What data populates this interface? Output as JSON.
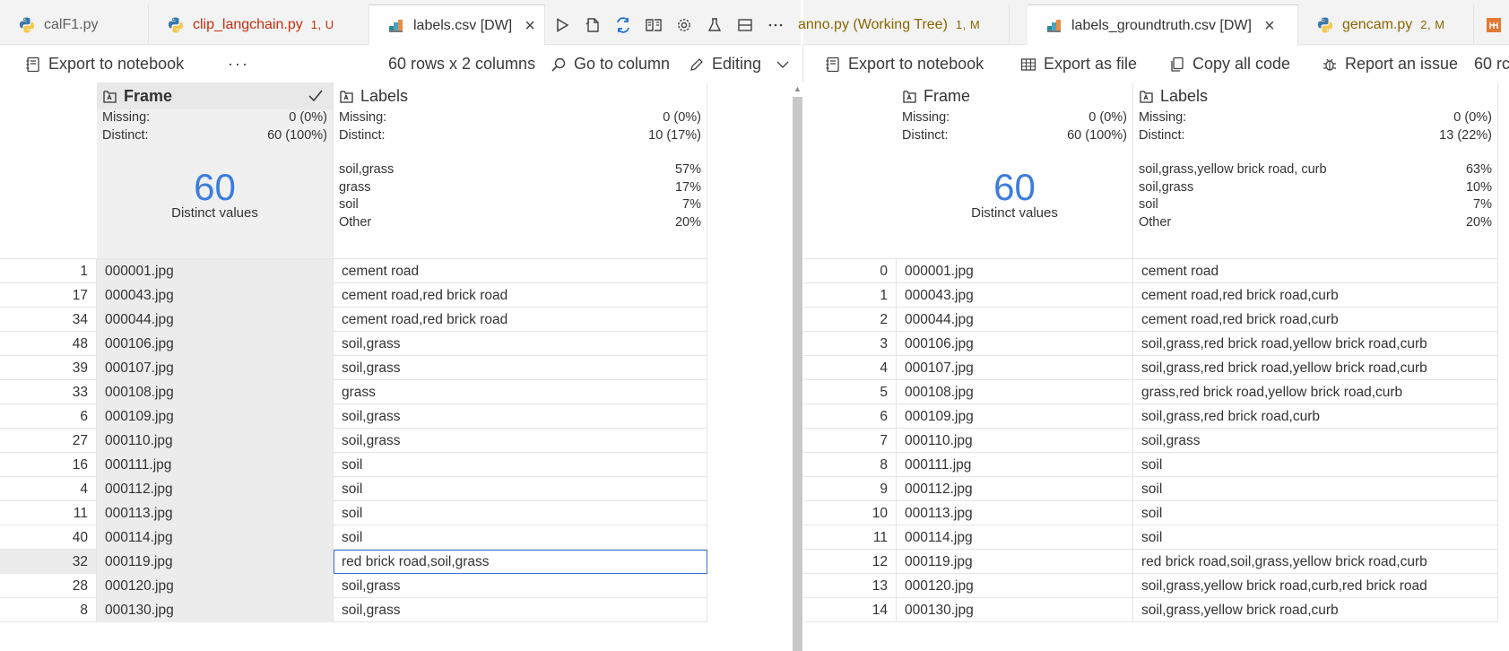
{
  "tabs_left": [
    {
      "label": "calF1.py",
      "mod": "",
      "style": "plain",
      "icon": "python-icon"
    },
    {
      "label": "clip_langchain.py",
      "mod": "1, U",
      "style": "red",
      "icon": "python-icon"
    },
    {
      "label": "labels.csv [DW]",
      "mod": "",
      "style": "active",
      "icon": "data-wrangler-icon"
    }
  ],
  "tabs_right": [
    {
      "label": "anno.py (Working Tree)",
      "mod": "1, M",
      "style": "yellow",
      "icon": ""
    },
    {
      "label": "labels_groundtruth.csv [DW]",
      "mod": "",
      "style": "active",
      "icon": "data-wrangler-icon"
    },
    {
      "label": "gencam.py",
      "mod": "2, M",
      "style": "yellow",
      "icon": "python-icon"
    }
  ],
  "tab_close_glyph": "×",
  "tab_actions": [
    "run-icon",
    "open-file-icon",
    "compare-icon",
    "preview-icon",
    "gear-icon",
    "flask-icon",
    "split-editor-icon",
    "more-icon"
  ],
  "left_toolbar": {
    "export_notebook": "Export to notebook",
    "more": "···",
    "summary": "60 rows x 2 columns",
    "goto_column": "Go to column",
    "editing": "Editing"
  },
  "right_toolbar": {
    "export_notebook": "Export to notebook",
    "export_file": "Export as file",
    "copy_code": "Copy all code",
    "report_issue": "Report an issue",
    "summary_partial": "60 rc"
  },
  "left_grid": {
    "columns": [
      {
        "name": "Frame",
        "selected": true,
        "missing_label": "Missing:",
        "missing": "0 (0%)",
        "distinct_label": "Distinct:",
        "distinct": "60 (100%)",
        "big_number": "60",
        "big_caption": "Distinct values"
      },
      {
        "name": "Labels",
        "selected": false,
        "missing_label": "Missing:",
        "missing": "0 (0%)",
        "distinct_label": "Distinct:",
        "distinct": "10 (17%)",
        "top_values": [
          {
            "value": "soil,grass",
            "pct": "57%"
          },
          {
            "value": "grass",
            "pct": "17%"
          },
          {
            "value": "soil",
            "pct": "7%"
          },
          {
            "value": "Other",
            "pct": "20%"
          }
        ]
      }
    ],
    "rows": [
      {
        "idx": "1",
        "frame": "000001.jpg",
        "labels": "cement road"
      },
      {
        "idx": "17",
        "frame": "000043.jpg",
        "labels": "cement road,red brick road"
      },
      {
        "idx": "34",
        "frame": "000044.jpg",
        "labels": "cement road,red brick road"
      },
      {
        "idx": "48",
        "frame": "000106.jpg",
        "labels": "soil,grass"
      },
      {
        "idx": "39",
        "frame": "000107.jpg",
        "labels": "soil,grass"
      },
      {
        "idx": "33",
        "frame": "000108.jpg",
        "labels": "grass"
      },
      {
        "idx": "6",
        "frame": "000109.jpg",
        "labels": "soil,grass"
      },
      {
        "idx": "27",
        "frame": "000110.jpg",
        "labels": "soil,grass"
      },
      {
        "idx": "16",
        "frame": "000111.jpg",
        "labels": "soil"
      },
      {
        "idx": "4",
        "frame": "000112.jpg",
        "labels": "soil"
      },
      {
        "idx": "11",
        "frame": "000113.jpg",
        "labels": "soil"
      },
      {
        "idx": "40",
        "frame": "000114.jpg",
        "labels": "soil"
      },
      {
        "idx": "32",
        "frame": "000119.jpg",
        "labels": "red brick road,soil,grass",
        "focused": true
      },
      {
        "idx": "28",
        "frame": "000120.jpg",
        "labels": "soil,grass"
      },
      {
        "idx": "8",
        "frame": "000130.jpg",
        "labels": "soil,grass"
      }
    ]
  },
  "right_grid": {
    "columns": [
      {
        "name": "Frame",
        "missing_label": "Missing:",
        "missing": "0 (0%)",
        "distinct_label": "Distinct:",
        "distinct": "60 (100%)",
        "big_number": "60",
        "big_caption": "Distinct values"
      },
      {
        "name": "Labels",
        "missing_label": "Missing:",
        "missing": "0 (0%)",
        "distinct_label": "Distinct:",
        "distinct": "13 (22%)",
        "top_values": [
          {
            "value": "soil,grass,yellow brick road, curb",
            "pct": "63%"
          },
          {
            "value": "soil,grass",
            "pct": "10%"
          },
          {
            "value": "soil",
            "pct": "7%"
          },
          {
            "value": "Other",
            "pct": "20%"
          }
        ]
      }
    ],
    "rows": [
      {
        "idx": "0",
        "frame": "000001.jpg",
        "labels": "cement road"
      },
      {
        "idx": "1",
        "frame": "000043.jpg",
        "labels": "cement road,red brick road,curb"
      },
      {
        "idx": "2",
        "frame": "000044.jpg",
        "labels": "cement road,red brick road,curb"
      },
      {
        "idx": "3",
        "frame": "000106.jpg",
        "labels": "soil,grass,red brick road,yellow brick road,curb"
      },
      {
        "idx": "4",
        "frame": "000107.jpg",
        "labels": "soil,grass,red brick road,yellow brick road,curb"
      },
      {
        "idx": "5",
        "frame": "000108.jpg",
        "labels": "grass,red brick road,yellow brick road,curb"
      },
      {
        "idx": "6",
        "frame": "000109.jpg",
        "labels": "soil,grass,red brick road,curb"
      },
      {
        "idx": "7",
        "frame": "000110.jpg",
        "labels": "soil,grass"
      },
      {
        "idx": "8",
        "frame": "000111.jpg",
        "labels": "soil"
      },
      {
        "idx": "9",
        "frame": "000112.jpg",
        "labels": "soil"
      },
      {
        "idx": "10",
        "frame": "000113.jpg",
        "labels": "soil"
      },
      {
        "idx": "11",
        "frame": "000114.jpg",
        "labels": "soil"
      },
      {
        "idx": "12",
        "frame": "000119.jpg",
        "labels": "red brick road,soil,grass,yellow brick road,curb"
      },
      {
        "idx": "13",
        "frame": "000120.jpg",
        "labels": "soil,grass,yellow brick road,curb,red brick road"
      },
      {
        "idx": "14",
        "frame": "000130.jpg",
        "labels": "soil,grass,yellow brick road,curb"
      }
    ]
  },
  "colors": {
    "accent_blue": "#3b7ddd",
    "focus_border": "#3b6fd8",
    "modified_red": "#c72e0f",
    "modified_yellow": "#8a6600"
  }
}
